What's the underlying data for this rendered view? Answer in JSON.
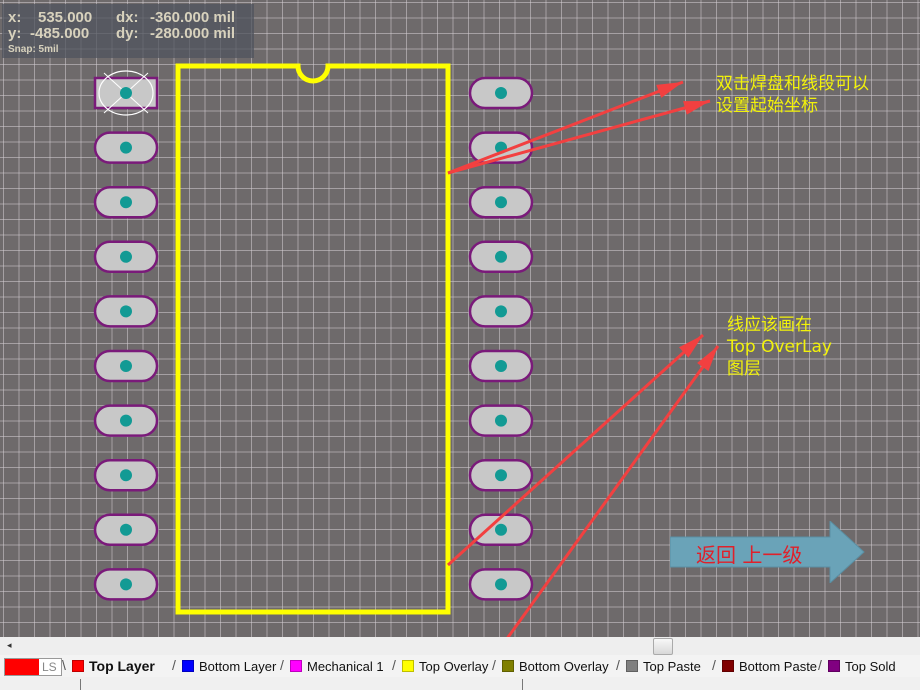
{
  "coords": {
    "x_label": "x:",
    "x_value": "535.000",
    "dx_label": "dx:",
    "dx_value": "-360.000 mil",
    "y_label": "y:",
    "y_value": "-485.000",
    "dy_label": "dy:",
    "dy_value": "-280.000 mil",
    "snap": "Snap: 5mil"
  },
  "annotations": {
    "note1_line1": "双击焊盘和线段可以",
    "note1_line2": "设置起始坐标",
    "note2_line1": "线应该画在",
    "note2_line2": "Top OverLay",
    "note2_line3": "图层"
  },
  "back_button": {
    "label": "返回  上一级",
    "color": "#6aa3b8",
    "text_color": "#e0202a"
  },
  "component": {
    "pins_per_side": 10,
    "outline_color": "#ffff00",
    "pad_fill": "#c8c8c8",
    "pad_border": "#7a1a7a",
    "hole_color": "#129a94",
    "pin1_shape": "square"
  },
  "arrow_color": "#f24040",
  "scrollbar": {
    "left_arrow": "◂"
  },
  "layer_selector": {
    "current_color": "#ff0000",
    "label": "LS"
  },
  "layers": [
    {
      "name": "Top Layer",
      "color": "#ff0000",
      "active": true
    },
    {
      "name": "Bottom Layer",
      "color": "#0000ff",
      "active": false
    },
    {
      "name": "Mechanical 1",
      "color": "#ff00ff",
      "active": false
    },
    {
      "name": "Top Overlay",
      "color": "#ffff00",
      "active": false
    },
    {
      "name": "Bottom Overlay",
      "color": "#808000",
      "active": false
    },
    {
      "name": "Top Paste",
      "color": "#808080",
      "active": false
    },
    {
      "name": "Bottom Paste",
      "color": "#800000",
      "active": false
    },
    {
      "name": "Top Solder",
      "color": "#800080",
      "active": false,
      "display": "Top Sold"
    }
  ]
}
